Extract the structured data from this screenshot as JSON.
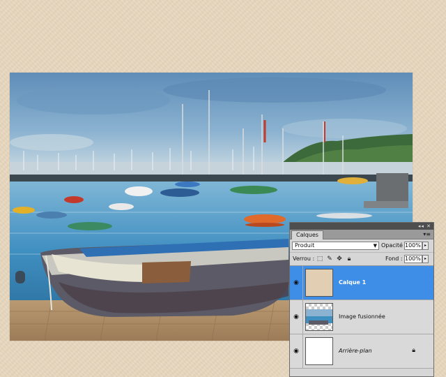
{
  "panel": {
    "tab_label": "Calques",
    "menu_icon": "panel-menu-icon",
    "blend_mode": "Produit",
    "opacity_label": "Opacité :",
    "opacity_value": "100%",
    "lock_label": "Verrou :",
    "fill_label": "Fond :",
    "fill_value": "100%",
    "layers": [
      {
        "name": "Calque 1",
        "selected": true
      },
      {
        "name": "Image fusionnée",
        "selected": false
      },
      {
        "name": "Arrière-plan",
        "selected": false,
        "locked": true
      }
    ]
  },
  "colors": {
    "background": "#e7d6bd",
    "selection": "#3e8ee8",
    "panel": "#d6d6d6"
  }
}
